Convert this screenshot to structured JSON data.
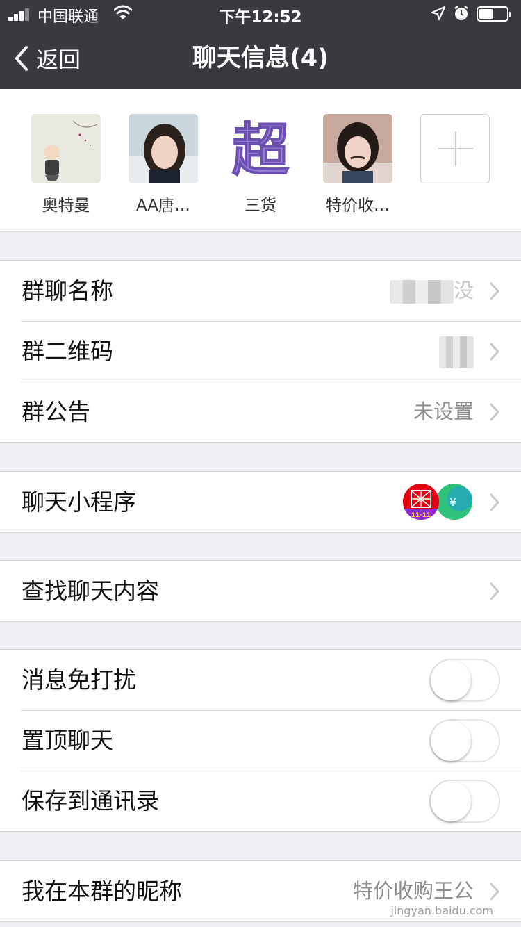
{
  "status_bar": {
    "carrier": "中国联通",
    "time": "下午12:52"
  },
  "nav": {
    "back_label": "返回",
    "title": "聊天信息(4)"
  },
  "members": [
    {
      "name": "奥特曼"
    },
    {
      "name": "AA唐…"
    },
    {
      "name": "三货"
    },
    {
      "name": "特价收…"
    }
  ],
  "group_info": {
    "name_label": "群聊名称",
    "name_value_suffix": "没",
    "qr_label": "群二维码",
    "notice_label": "群公告",
    "notice_value": "未设置"
  },
  "miniprograms": {
    "label": "聊天小程序",
    "icon1_text": "11·11",
    "icon2_text": "¥"
  },
  "search": {
    "label": "查找聊天内容"
  },
  "toggles": {
    "mute_label": "消息免打扰",
    "mute_on": false,
    "pin_label": "置顶聊天",
    "pin_on": false,
    "save_label": "保存到通讯录",
    "save_on": false
  },
  "nickname": {
    "label": "我在本群的昵称",
    "value": "特价收购王公"
  },
  "watermark": "jingyan.baidu.com",
  "colors": {
    "nav_bg": "#393a3f",
    "page_bg": "#efeff4",
    "separator": "#d9d9d9"
  }
}
